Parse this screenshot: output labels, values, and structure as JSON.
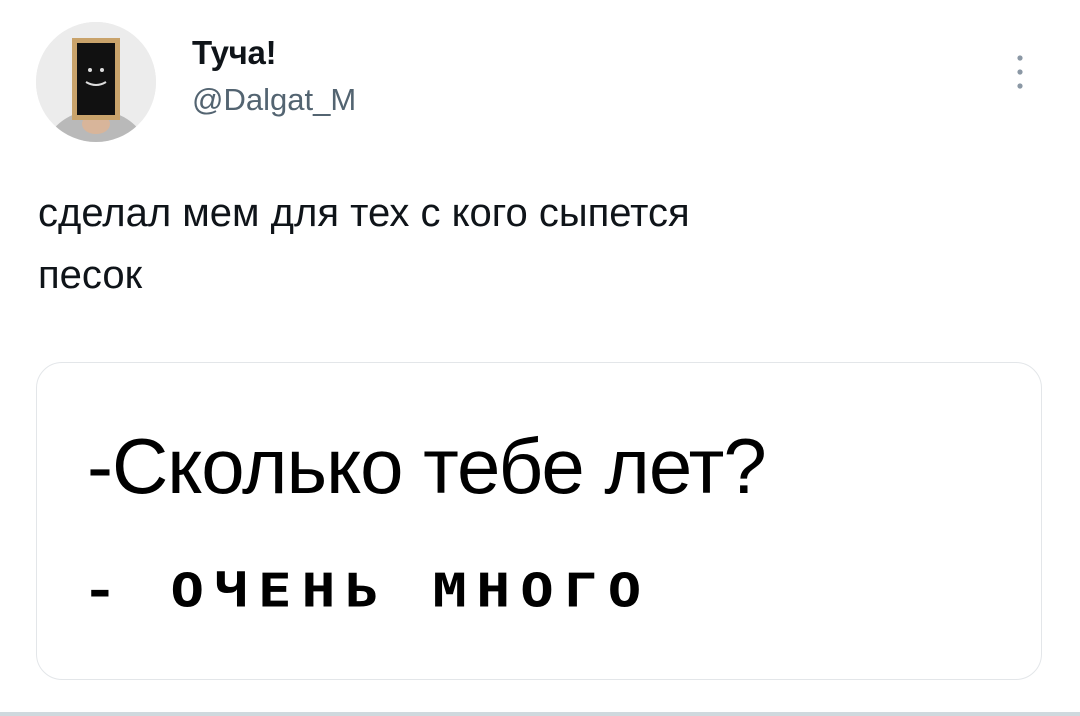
{
  "author": {
    "display_name": "Туча!",
    "handle": "@Dalgat_M"
  },
  "tweet": {
    "text_line_1": "сделал мем для тех с кого сыпется",
    "text_line_2": "песок"
  },
  "media": {
    "line_1": "-Сколько тебе лет?",
    "line_2": "- ОЧЕНЬ МНОГО"
  },
  "icons": {
    "more": "more-vertical-icon"
  },
  "colors": {
    "text": "#0f1419",
    "secondary_text": "#536471",
    "border": "#e3e6e9"
  }
}
